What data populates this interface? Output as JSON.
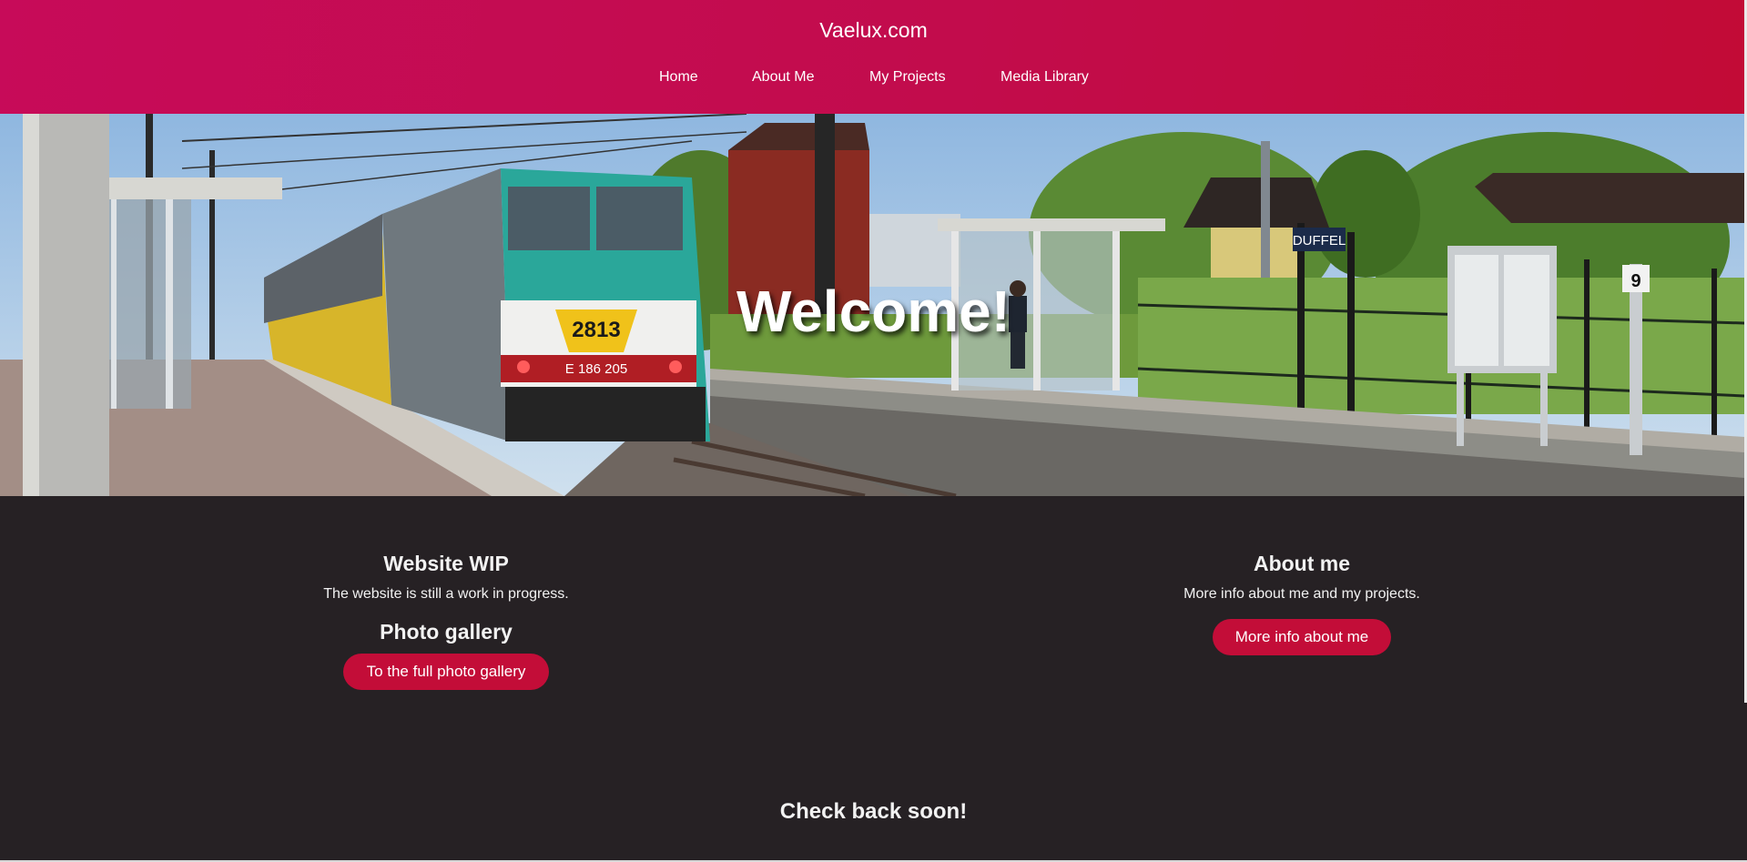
{
  "header": {
    "site_title": "Vaelux.com",
    "nav": [
      "Home",
      "About Me",
      "My Projects",
      "Media Library"
    ]
  },
  "hero": {
    "title": "Welcome!",
    "sign_station": "DUFFEL",
    "sign_platform": "9",
    "loco_number": "2813",
    "loco_id": "E 186 205"
  },
  "left": {
    "wip_title": "Website WIP",
    "wip_text": "The website is still a work in progress.",
    "gallery_title": "Photo gallery",
    "gallery_button": "To the full photo gallery"
  },
  "right": {
    "about_title": "About me",
    "about_text": "More info about me and my projects.",
    "about_button": "More info about me"
  },
  "footer": {
    "text": "Check back soon!"
  },
  "colors": {
    "header": "#c20c4c",
    "button": "#c30d38",
    "background": "#262124"
  }
}
